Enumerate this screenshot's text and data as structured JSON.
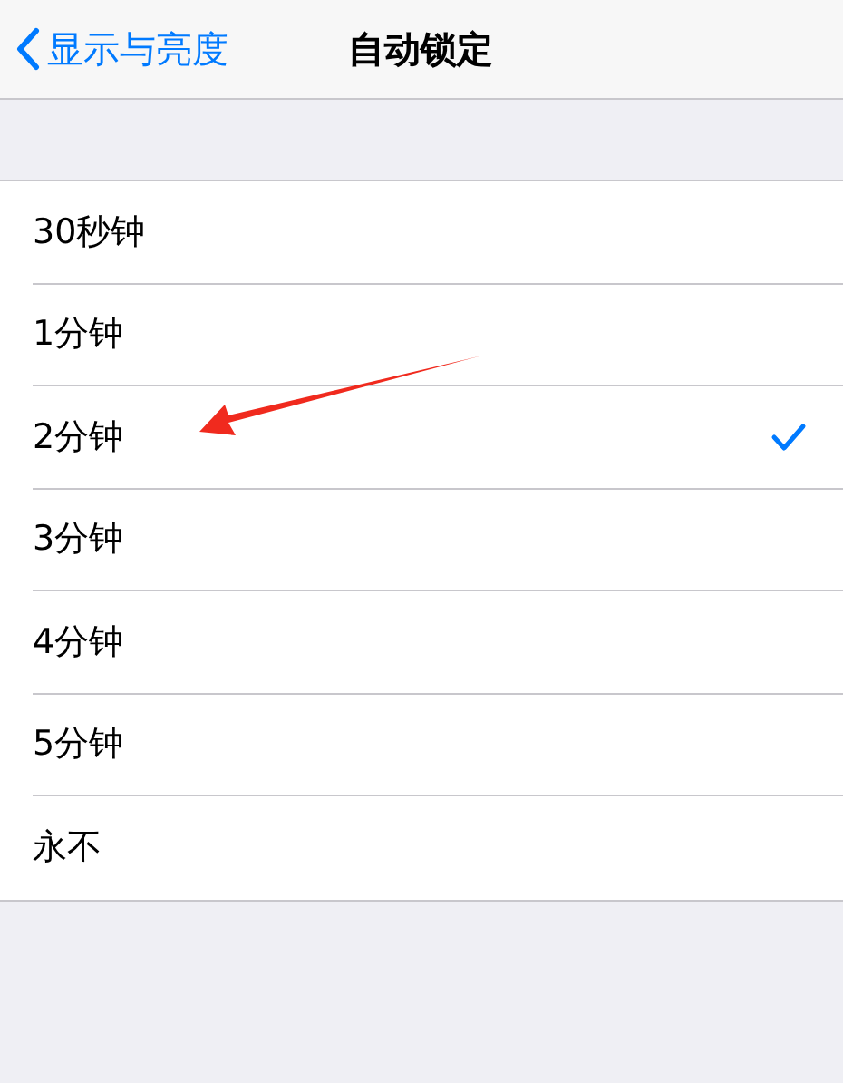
{
  "nav_bar": {
    "back_label": "显示与亮度",
    "title": "自动锁定"
  },
  "options": [
    {
      "label": "30秒钟",
      "selected": false
    },
    {
      "label": "1分钟",
      "selected": false
    },
    {
      "label": "2分钟",
      "selected": true
    },
    {
      "label": "3分钟",
      "selected": false
    },
    {
      "label": "4分钟",
      "selected": false
    },
    {
      "label": "5分钟",
      "selected": false
    },
    {
      "label": "永不",
      "selected": false
    }
  ]
}
